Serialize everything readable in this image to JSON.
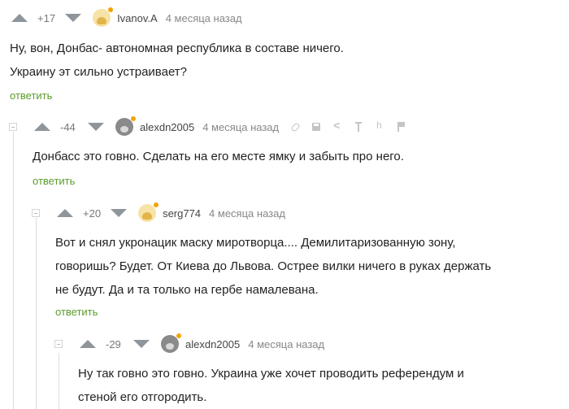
{
  "colors": {
    "accent_green": "#5a9c2c",
    "vote_gray": "#8e959b",
    "avatar_online": "#f2a500"
  },
  "comments": [
    {
      "rating": "+17",
      "username": "Ivanov.A",
      "time": "4 месяца назад",
      "lines": [
        "Ну, вон, Донбас- автономная республика в составе ничего.",
        "Украину эт сильно устраивает?"
      ],
      "reply": "ответить",
      "avatar_icon": "chick-avatar-icon"
    },
    {
      "rating": "-44",
      "username": "alexdn2005",
      "time": "4 месяца назад",
      "lines": [
        "Донбасс это говно. Сделать на его месте ямку и забыть про него."
      ],
      "reply": "ответить",
      "avatar_icon": "cat-avatar-icon",
      "tool_icons": [
        "link-icon",
        "save-icon",
        "share-icon",
        "go-up-icon",
        "thread-icon",
        "flag-icon"
      ]
    },
    {
      "rating": "+20",
      "username": "serg774",
      "time": "4 месяца назад",
      "lines": [
        "Вот и снял укронацик маску миротворца.... Демилитаризованную зону,",
        "говоришь? Будет. От Киева до Львова. Острее вилки ничего в руках держать",
        "не будут. Да и та только на гербе намалевана."
      ],
      "reply": "ответить",
      "avatar_icon": "chick-avatar-icon"
    },
    {
      "rating": "-29",
      "username": "alexdn2005",
      "time": "4 месяца назад",
      "lines": [
        "Ну так говно это говно. Украина уже хочет проводить референдум и",
        "стеной его отгородить."
      ],
      "avatar_icon": "cat-avatar-icon"
    }
  ]
}
